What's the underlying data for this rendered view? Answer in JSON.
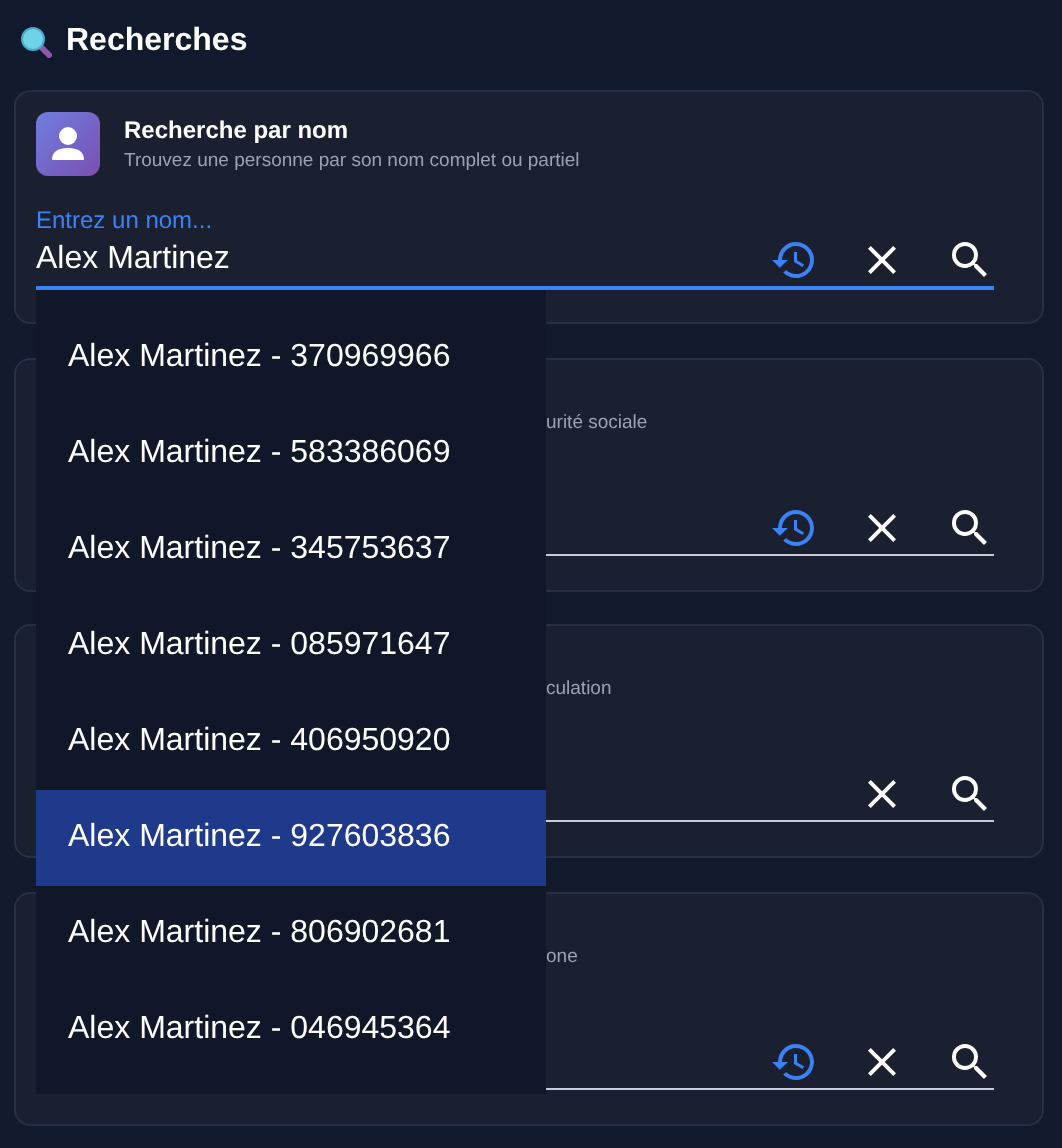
{
  "title": "Recherches",
  "cards": [
    {
      "title": "Recherche par nom",
      "subtitle": "Trouvez une personne par son nom complet ou partiel",
      "label": "Entrez un nom...",
      "value": "Alex Martinez",
      "focused": true,
      "history": true,
      "dropdown": [
        {
          "text": "Alex Martinez - 370969966",
          "selected": false
        },
        {
          "text": "Alex Martinez - 583386069",
          "selected": false
        },
        {
          "text": "Alex Martinez - 345753637",
          "selected": false
        },
        {
          "text": "Alex Martinez - 085971647",
          "selected": false
        },
        {
          "text": "Alex Martinez - 406950920",
          "selected": false
        },
        {
          "text": "Alex Martinez - 927603836",
          "selected": true
        },
        {
          "text": "Alex Martinez - 806902681",
          "selected": false
        },
        {
          "text": "Alex Martinez - 046945364",
          "selected": false
        }
      ]
    },
    {
      "subtitle": "urité sociale",
      "focused": false,
      "history": true
    },
    {
      "subtitle": "culation",
      "focused": false,
      "history": false
    },
    {
      "subtitle": "one",
      "focused": false,
      "history": true
    }
  ]
}
